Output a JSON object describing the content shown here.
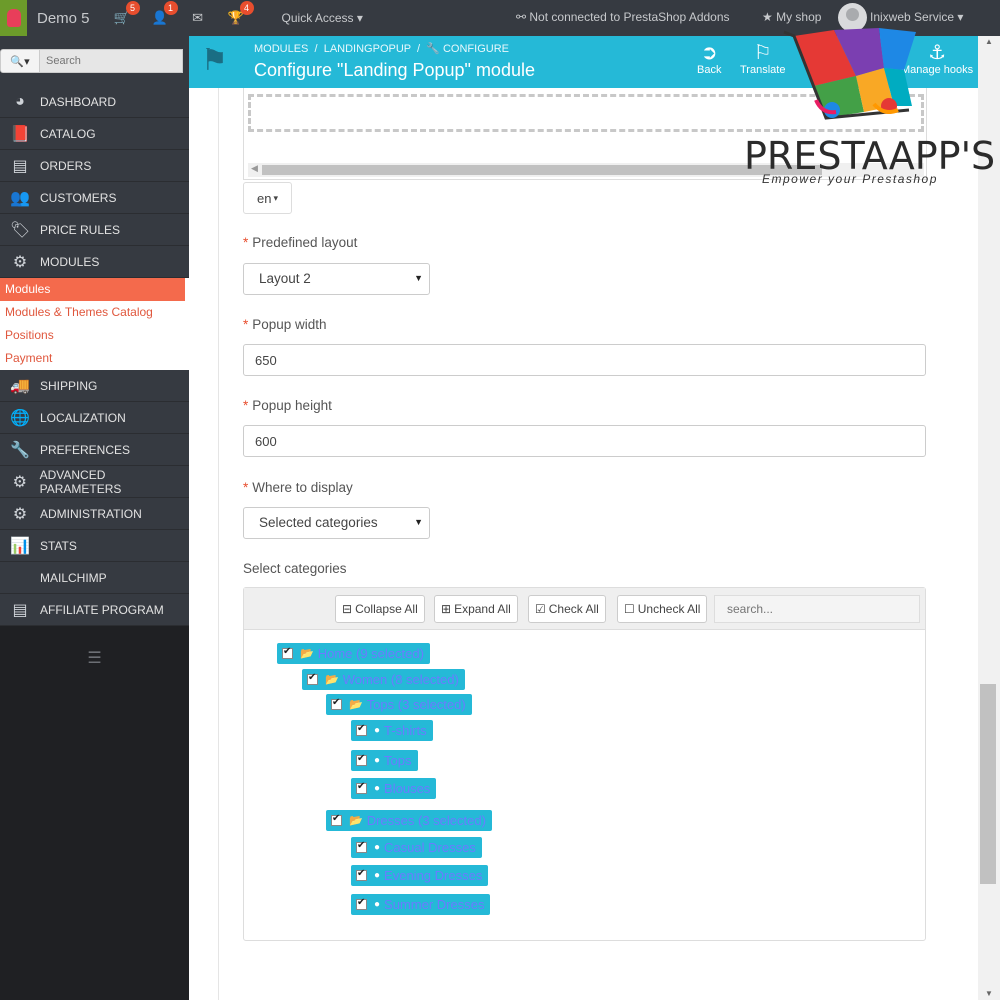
{
  "topbar": {
    "shop_name": "Demo 5",
    "cart_count": "5",
    "customers_count": "1",
    "messages_count": "",
    "trophy_count": "4",
    "quick_access": "Quick Access",
    "addons_status": "Not connected to PrestaShop Addons",
    "my_shop": "My shop",
    "user_name": "Inixweb Service"
  },
  "sidebar": {
    "search_placeholder": "Search",
    "items": [
      {
        "label": "DASHBOARD",
        "icon": "dashboard-icon"
      },
      {
        "label": "CATALOG",
        "icon": "book-icon"
      },
      {
        "label": "ORDERS",
        "icon": "credit-card-icon"
      },
      {
        "label": "CUSTOMERS",
        "icon": "users-icon"
      },
      {
        "label": "PRICE RULES",
        "icon": "tags-icon"
      },
      {
        "label": "MODULES",
        "icon": "puzzle-icon"
      },
      {
        "label": "SHIPPING",
        "icon": "truck-icon"
      },
      {
        "label": "LOCALIZATION",
        "icon": "globe-icon"
      },
      {
        "label": "PREFERENCES",
        "icon": "wrench-icon"
      },
      {
        "label": "ADVANCED PARAMETERS",
        "icon": "cogs-icon"
      },
      {
        "label": "ADMINISTRATION",
        "icon": "cog-icon"
      },
      {
        "label": "STATS",
        "icon": "bar-chart-icon"
      },
      {
        "label": "MAILCHIMP",
        "icon": ""
      },
      {
        "label": "AFFILIATE PROGRAM",
        "icon": "sitemap-icon"
      }
    ],
    "modules_submenu": [
      "Modules",
      "Modules & Themes Catalog",
      "Positions",
      "Payment"
    ]
  },
  "header": {
    "breadcrumb_1": "MODULES",
    "breadcrumb_2": "LANDINGPOPUP",
    "breadcrumb_3": "CONFIGURE",
    "title": "Configure \"Landing Popup\" module",
    "back": "Back",
    "translate": "Translate",
    "manage_hooks": "Manage hooks"
  },
  "form": {
    "language": "en",
    "layout_label": "Predefined layout",
    "layout_value": "Layout 2",
    "width_label": "Popup width",
    "width_value": "650",
    "height_label": "Popup height",
    "height_value": "600",
    "display_label": "Where to display",
    "display_value": "Selected categories",
    "categories_label": "Select categories"
  },
  "tree": {
    "collapse_all": "Collapse All",
    "expand_all": "Expand All",
    "check_all": "Check All",
    "uncheck_all": "Uncheck All",
    "search_placeholder": "search...",
    "nodes": {
      "home": "Home (9 selected)",
      "women": "Women (8 selected)",
      "tops": "Tops (3 selected)",
      "tshirts": "T-shirts",
      "tops_leaf": "Tops",
      "blouses": "Blouses",
      "dresses": "Dresses (3 selected)",
      "casual": "Casual Dresses",
      "evening": "Evening Dresses",
      "summer": "Summer Dresses"
    }
  },
  "watermark": {
    "brand_presta": "PRESTA",
    "brand_apps": "APP'S",
    "tagline": "Empower your Prestashop"
  }
}
